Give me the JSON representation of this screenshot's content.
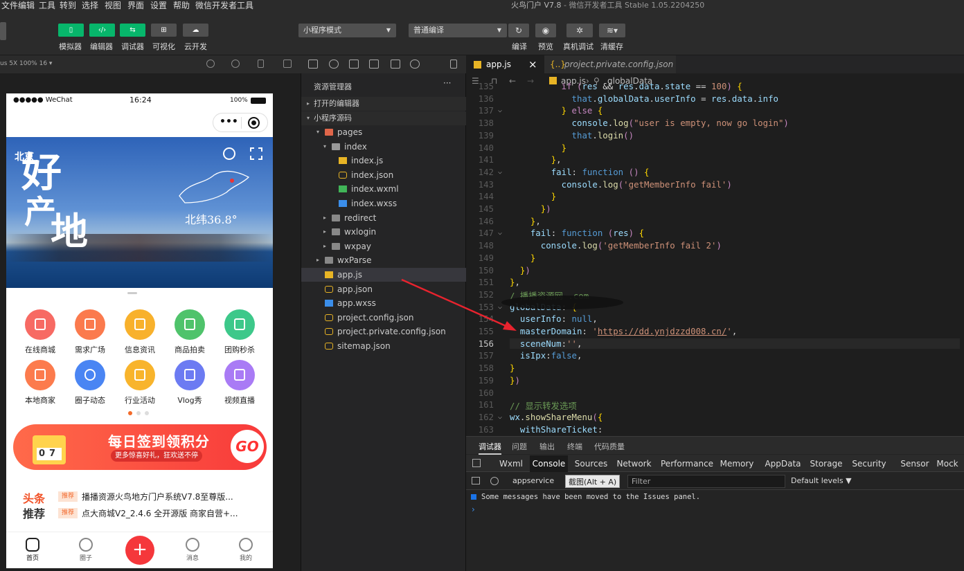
{
  "menu": {
    "items": [
      "文件",
      "编辑",
      "工具",
      "转到",
      "选择",
      "视图",
      "界面",
      "设置",
      "帮助",
      "微信开发者工具"
    ]
  },
  "window": {
    "title": "火鸟门户 V7.8",
    "subtitle": " - 微信开发者工具 Stable 1.05.2204250"
  },
  "toolbar": {
    "left_buttons": [
      "模拟器",
      "编辑器",
      "调试器",
      "可视化",
      "云开发"
    ],
    "mode_select": "小程序模式",
    "compile_select": "普通编译",
    "right_buttons": [
      "编译",
      "预览",
      "真机调试",
      "清缓存"
    ]
  },
  "simulator": {
    "device_info": "us 5X 100% 16 ▾",
    "status": {
      "carrier": "●●●●● WeChat",
      "time": "16:24",
      "battery": "100%"
    },
    "banner": {
      "city": "北京",
      "calligraphy": [
        "好",
        "产",
        "地"
      ],
      "latitude": "北纬36.8°"
    },
    "grid": [
      {
        "label": "在线商城",
        "color": "#f76a63"
      },
      {
        "label": "需求广场",
        "color": "#fb7a4d"
      },
      {
        "label": "信息资讯",
        "color": "#f8b12c"
      },
      {
        "label": "商品拍卖",
        "color": "#4fc36b"
      },
      {
        "label": "团购秒杀",
        "color": "#3dc88a"
      },
      {
        "label": "本地商家",
        "color": "#fc7b4d"
      },
      {
        "label": "圈子动态",
        "color": "#4a85f3"
      },
      {
        "label": "行业活动",
        "color": "#f8b42c"
      },
      {
        "label": "Vlog秀",
        "color": "#6c7bf2"
      },
      {
        "label": "视频直播",
        "color": "#a97bf5"
      }
    ],
    "promo": {
      "title": "每日签到领积分",
      "subtitle": "更多惊喜好礼，狂欢送不停",
      "calendar": "07",
      "go": "GO"
    },
    "news": {
      "logo_top": "头条",
      "logo_bottom": "推荐",
      "items": [
        {
          "tag": "推荐",
          "text": "播播资源火鸟地方门户系统V7.8至尊版..."
        },
        {
          "tag": "推荐",
          "text": "点大商城V2_2.4.6 全开源版 商家自营+..."
        }
      ]
    },
    "tabbar": [
      "首页",
      "圈子",
      "",
      "消息",
      "我的"
    ]
  },
  "explorer": {
    "title": "资源管理器",
    "more": "···",
    "sections": [
      "打开的编辑器",
      "小程序源码"
    ],
    "tree": [
      {
        "label": "pages",
        "indent": 1,
        "type": "folder-open",
        "arrow": "▾"
      },
      {
        "label": "index",
        "indent": 2,
        "type": "folder-open",
        "arrow": "▾"
      },
      {
        "label": "index.js",
        "indent": 3,
        "type": "js"
      },
      {
        "label": "index.json",
        "indent": 3,
        "type": "json"
      },
      {
        "label": "index.wxml",
        "indent": 3,
        "type": "wxml"
      },
      {
        "label": "index.wxss",
        "indent": 3,
        "type": "wxss"
      },
      {
        "label": "redirect",
        "indent": 2,
        "type": "folder",
        "arrow": "▸"
      },
      {
        "label": "wxlogin",
        "indent": 2,
        "type": "folder",
        "arrow": "▸"
      },
      {
        "label": "wxpay",
        "indent": 2,
        "type": "folder",
        "arrow": "▸"
      },
      {
        "label": "wxParse",
        "indent": 1,
        "type": "folder",
        "arrow": "▸"
      },
      {
        "label": "app.js",
        "indent": 1,
        "type": "js",
        "selected": true
      },
      {
        "label": "app.json",
        "indent": 1,
        "type": "json"
      },
      {
        "label": "app.wxss",
        "indent": 1,
        "type": "wxss"
      },
      {
        "label": "project.config.json",
        "indent": 1,
        "type": "json"
      },
      {
        "label": "project.private.config.json",
        "indent": 1,
        "type": "json"
      },
      {
        "label": "sitemap.json",
        "indent": 1,
        "type": "json"
      }
    ]
  },
  "editor": {
    "tabs": [
      {
        "label": "app.js",
        "close": "×",
        "active": true
      },
      {
        "label": "project.private.config.json",
        "active": false
      }
    ],
    "breadcrumb": {
      "file": "app.js",
      "symbol": "globalData"
    },
    "current_line": 156,
    "lines": [
      {
        "n": 135,
        "t": "          if (res && res.data.state == 100) {"
      },
      {
        "n": 136,
        "t": "            that.globalData.userInfo = res.data.info"
      },
      {
        "n": 137,
        "t": "          } else {"
      },
      {
        "n": 138,
        "t": "            console.log(\"user is empty, now go login\")"
      },
      {
        "n": 139,
        "t": "            that.login()"
      },
      {
        "n": 140,
        "t": "          }"
      },
      {
        "n": 141,
        "t": "        },"
      },
      {
        "n": 142,
        "t": "        fail: function () {"
      },
      {
        "n": 143,
        "t": "          console.log('getMemberInfo fail')"
      },
      {
        "n": 144,
        "t": "        }"
      },
      {
        "n": 145,
        "t": "      })"
      },
      {
        "n": 146,
        "t": "    },"
      },
      {
        "n": 147,
        "t": "    fail: function (res) {"
      },
      {
        "n": 148,
        "t": "      console.log('getMemberInfo fail 2')"
      },
      {
        "n": 149,
        "t": "    }"
      },
      {
        "n": 150,
        "t": "  })"
      },
      {
        "n": 151,
        "t": "},"
      },
      {
        "n": 152,
        "t": "/ 播播资源网 .com"
      },
      {
        "n": 153,
        "t": "globalData: {"
      },
      {
        "n": 154,
        "t": "  userInfo: null,"
      },
      {
        "n": 155,
        "t": "  masterDomain: 'https://dd.ynjdzzd008.cn/',"
      },
      {
        "n": 156,
        "t": "  sceneNum:'',"
      },
      {
        "n": 157,
        "t": "  isIpx:false,"
      },
      {
        "n": 158,
        "t": "}"
      },
      {
        "n": 159,
        "t": "})"
      },
      {
        "n": 160,
        "t": ""
      },
      {
        "n": 161,
        "t": "// 显示转发选项"
      },
      {
        "n": 162,
        "t": "wx.showShareMenu({"
      },
      {
        "n": 163,
        "t": "  withShareTicket:"
      }
    ]
  },
  "devtools": {
    "top_tabs": [
      "调试器",
      "问题",
      "输出",
      "终端",
      "代码质量"
    ],
    "tabs": [
      "Wxml",
      "Console",
      "Sources",
      "Network",
      "Performance",
      "Memory",
      "AppData",
      "Storage",
      "Security",
      "Sensor",
      "Mock"
    ],
    "active_tab": "Console",
    "context": "appservice",
    "tooltip": "截图(Alt + A)",
    "filter_placeholder": "Filter",
    "levels": "Default levels ▼",
    "message": "Some messages have been moved to the Issues panel.",
    "prompt": "›"
  }
}
